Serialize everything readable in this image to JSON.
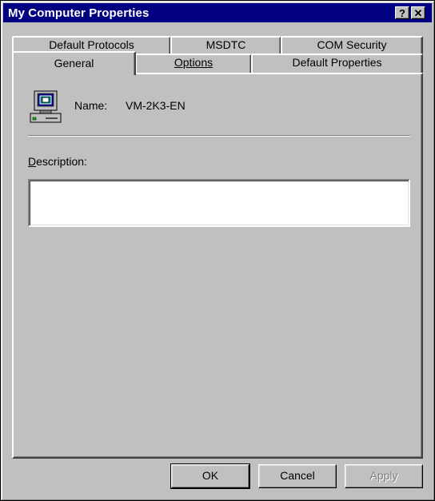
{
  "window": {
    "title": "My Computer Properties",
    "help_label": "?",
    "close_label": "✕"
  },
  "tabs": {
    "back_row": [
      {
        "label": "Default Protocols"
      },
      {
        "label": "MSDTC"
      },
      {
        "label": "COM Security"
      }
    ],
    "front_row": [
      {
        "label": "General",
        "selected": true
      },
      {
        "label": "Options"
      },
      {
        "label": "Default Properties"
      }
    ]
  },
  "general": {
    "icon": "computer-icon",
    "name_label": "Name:",
    "name_value": "VM-2K3-EN",
    "description_label": "Description:",
    "description_value": ""
  },
  "buttons": {
    "ok": "OK",
    "cancel": "Cancel",
    "apply": "Apply"
  },
  "colors": {
    "titlebar": "#000080",
    "face": "#c0c0c0"
  }
}
